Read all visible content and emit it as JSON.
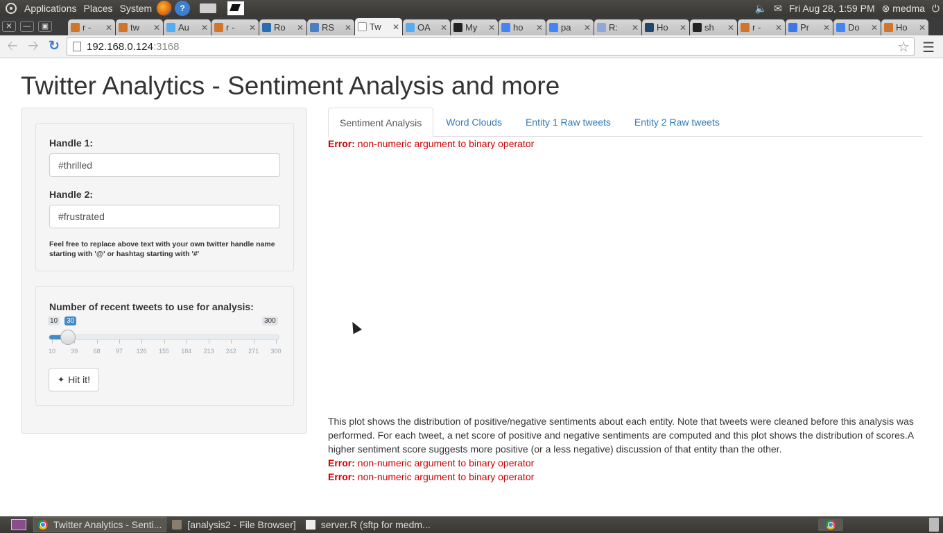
{
  "panel": {
    "menus": [
      "Applications",
      "Places",
      "System"
    ],
    "datetime": "Fri Aug 28,  1:59 PM",
    "user": "medma"
  },
  "browser_tabs": [
    {
      "title": "r -",
      "fav_color": "#d0752c"
    },
    {
      "title": "tw",
      "fav_color": "#d0752c"
    },
    {
      "title": "Au",
      "fav_color": "#55acee"
    },
    {
      "title": "r -",
      "fav_color": "#d0752c"
    },
    {
      "title": "Ro",
      "fav_color": "#2a6cb0"
    },
    {
      "title": "RS",
      "fav_color": "#4a7fc1"
    },
    {
      "title": "Tw",
      "fav_color": "#ffffff",
      "active": true
    },
    {
      "title": "OA",
      "fav_color": "#55acee"
    },
    {
      "title": "My",
      "fav_color": "#222222"
    },
    {
      "title": "ho",
      "fav_color": "#4285f4"
    },
    {
      "title": "pa",
      "fav_color": "#4285f4"
    },
    {
      "title": "R:",
      "fav_color": "#8fa8d8"
    },
    {
      "title": "Ho",
      "fav_color": "#224466"
    },
    {
      "title": "sh",
      "fav_color": "#222222"
    },
    {
      "title": "r -",
      "fav_color": "#d0752c"
    },
    {
      "title": "Pr",
      "fav_color": "#3b78e7"
    },
    {
      "title": "Do",
      "fav_color": "#4285f4"
    },
    {
      "title": "Ho",
      "fav_color": "#d0752c"
    }
  ],
  "address_bar": {
    "host": "192.168.0.124",
    "port": ":3168"
  },
  "page": {
    "title": "Twitter Analytics - Sentiment Analysis and more",
    "handle1_label": "Handle 1:",
    "handle1_value": "#thrilled",
    "handle2_label": "Handle 2:",
    "handle2_value": "#frustrated",
    "help_text": "Feel free to replace above text with your own twitter handle name starting with '@' or hashtag starting with '#'",
    "slider_label": "Number of recent tweets to use for analysis:",
    "slider_min": "10",
    "slider_max": "300",
    "slider_value": "30",
    "slider_ticks": [
      "10",
      "39",
      "68",
      "97",
      "126",
      "155",
      "184",
      "213",
      "242",
      "271",
      "300"
    ],
    "button_label": "Hit it!",
    "tabs": [
      "Sentiment Analysis",
      "Word Clouds",
      "Entity 1 Raw tweets",
      "Entity 2 Raw tweets"
    ],
    "error_label": "Error:",
    "error_message": "non-numeric argument to binary operator",
    "description": "This plot shows the distribution of positive/negative sentiments about each entity. Note that tweets were cleaned before this analysis was performed. For each tweet, a net score of positive and negative sentiments are computed and this plot shows the distribution of scores.A higher sentiment score suggests more positive (or a less negative) discussion of that entity than the other."
  },
  "taskbar": {
    "tasks": [
      "Twitter Analytics - Senti...",
      "[analysis2 - File Browser]",
      "server.R (sftp for medm..."
    ]
  }
}
